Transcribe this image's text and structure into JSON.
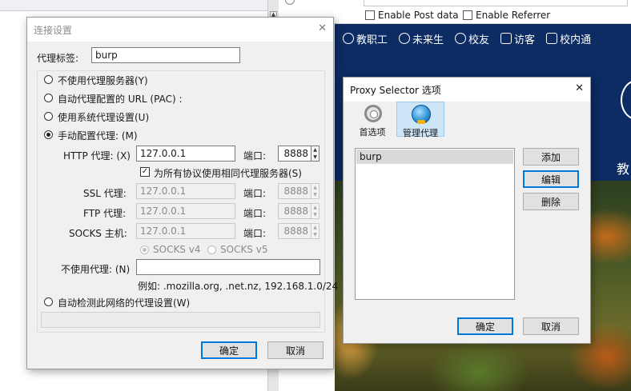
{
  "background": {
    "enable_post_data": "Enable Post data",
    "enable_referrer": "Enable Referrer",
    "nav": [
      "教职工",
      "未来生",
      "校友",
      "访客",
      "校内通"
    ],
    "side_text": "教"
  },
  "connection_dialog": {
    "title": "连接设置",
    "proxy_tag_label": "代理标签:",
    "proxy_tag_value": "burp",
    "options": {
      "no_proxy": "不使用代理服务器(Y)",
      "auto_pac": "自动代理配置的 URL (PAC) :",
      "system": "使用系统代理设置(U)",
      "manual": "手动配置代理: (M)"
    },
    "http_label": "HTTP 代理: (X)",
    "http_host": "127.0.0.1",
    "http_port_label": "端口:",
    "http_port": "8888",
    "same_proxy_label": "为所有协议使用相同代理服务器(S)",
    "ssl_label": "SSL 代理:",
    "ssl_host": "127.0.0.1",
    "ssl_port": "8888",
    "ftp_label": "FTP 代理:",
    "ftp_host": "127.0.0.1",
    "ftp_port": "8888",
    "socks_label": "SOCKS 主机:",
    "socks_host": "127.0.0.1",
    "socks_port": "8888",
    "port_label": "端口:",
    "socks_v4": "SOCKS v4",
    "socks_v5": "SOCKS v5",
    "no_proxy_for_label": "不使用代理: (N)",
    "no_proxy_for_value": "",
    "example": "例如: .mozilla.org, .net.nz, 192.168.1.0/24",
    "auto_detect": "自动检测此网络的代理设置(W)",
    "ok": "确定",
    "cancel": "取消"
  },
  "proxy_selector": {
    "title": "Proxy Selector 选项",
    "tabs": [
      "首选项",
      "管理代理"
    ],
    "list": [
      "burp"
    ],
    "add": "添加",
    "edit": "编辑",
    "delete": "删除",
    "ok": "确定",
    "cancel": "取消"
  }
}
